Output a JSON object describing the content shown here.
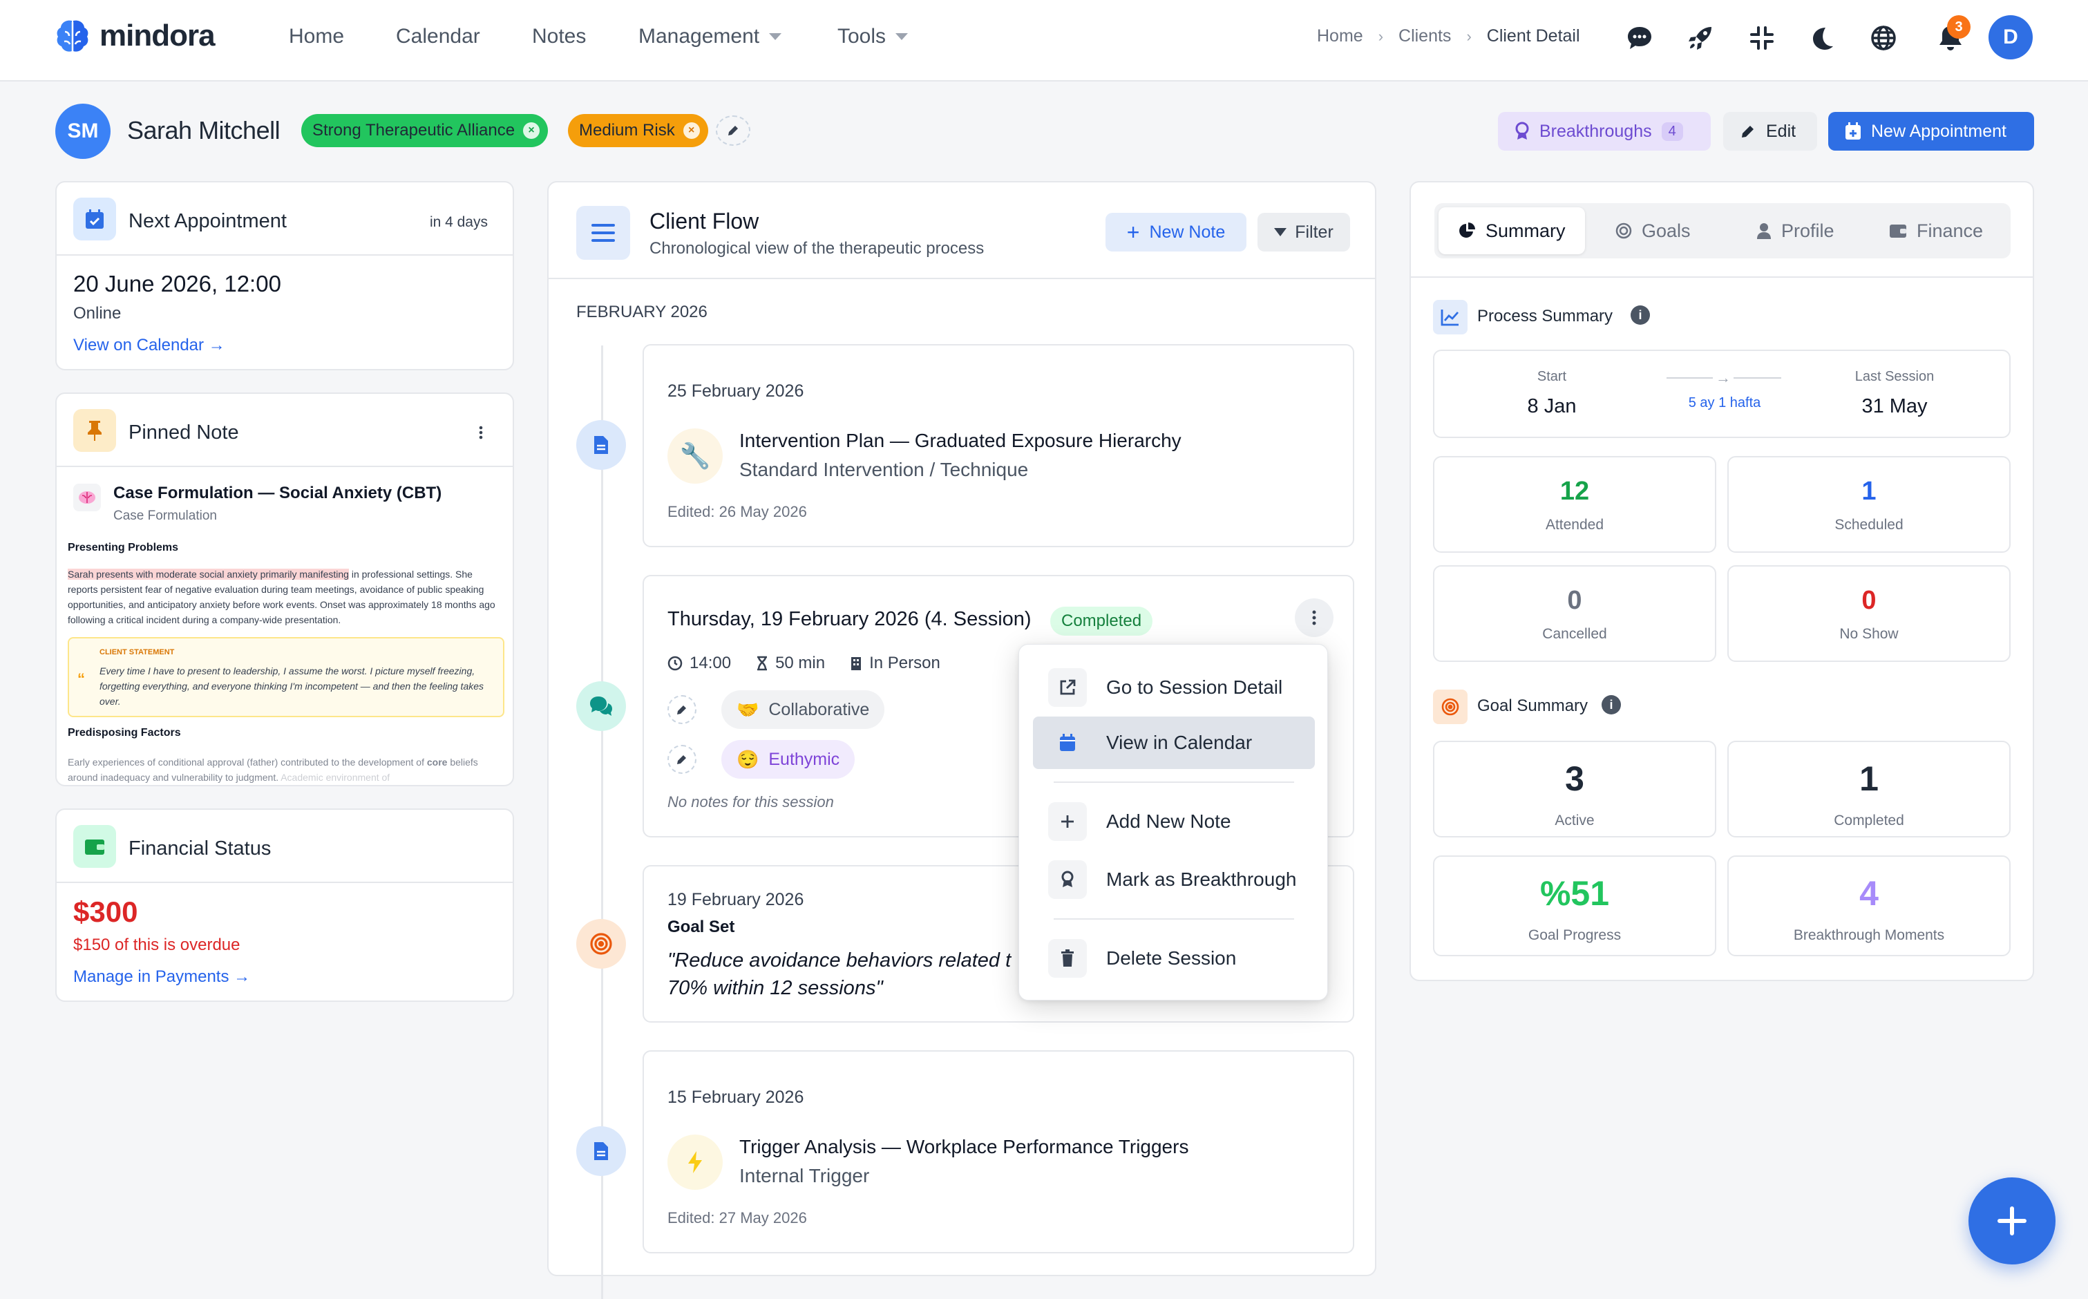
{
  "app": {
    "name": "mindora"
  },
  "nav": {
    "links": [
      "Home",
      "Calendar",
      "Notes",
      "Management",
      "Tools"
    ],
    "breadcrumb": [
      "Home",
      "Clients",
      "Client Detail"
    ],
    "notification_count": "3",
    "user_initial": "D",
    "icons": [
      "chat-icon",
      "rocket-icon",
      "compress-icon",
      "moon-icon",
      "globe-icon",
      "bell-icon"
    ]
  },
  "client": {
    "initials": "SM",
    "name": "Sarah Mitchell",
    "tags": [
      {
        "label": "Strong Therapeutic Alliance",
        "color": "#22c55e"
      },
      {
        "label": "Medium Risk",
        "color": "#f59e0b"
      }
    ]
  },
  "header_actions": {
    "breakthroughs_label": "Breakthroughs",
    "breakthroughs_count": "4",
    "edit_label": "Edit",
    "new_appointment_label": "New Appointment"
  },
  "next_appointment": {
    "title": "Next Appointment",
    "relative": "in 4 days",
    "datetime": "20 June 2026, 12:00",
    "mode": "Online",
    "link": "View on Calendar →"
  },
  "pinned_note": {
    "title": "Pinned Note",
    "note_title": "Case Formulation — Social Anxiety (CBT)",
    "note_type": "Case Formulation",
    "section1": "Presenting Problems",
    "highlight": "Sarah presents with moderate social anxiety primarily manifesting",
    "body": " in professional settings. She reports persistent fear of negative evaluation during team meetings, avoidance of public speaking opportunities, and anticipatory anxiety before work events. Onset was approximately 18 months ago following a critical incident during a company-wide presentation.",
    "quote_label": "CLIENT STATEMENT",
    "quote": "Every time I have to present to leadership, I assume the worst. I picture myself freezing, forgetting everything, and everyone thinking I'm incompetent — and then the feeling takes over.",
    "section2": "Predisposing Factors",
    "body2_a": "Early experiences of conditional approval (father) contributed to the development of ",
    "body2_b": "core",
    "body2_c": " beliefs around inadequacy and vulnerability to judgment. ",
    "body2_d": "Academic environment of"
  },
  "financial": {
    "title": "Financial Status",
    "amount": "$300",
    "overdue": "$150 of this is overdue",
    "link": "Manage in Payments →"
  },
  "flow": {
    "title": "Client Flow",
    "subtitle": "Chronological view of the therapeutic process",
    "new_note_label": "New Note",
    "filter_label": "Filter",
    "month": "FEBRUARY 2026",
    "items": [
      {
        "date": "25 February 2026",
        "title": "Intervention Plan — Graduated Exposure Hierarchy",
        "subtitle": "Standard Intervention / Technique",
        "edited": "Edited: 26 May 2026"
      },
      {
        "title": "Thursday, 19 February 2026 (4. Session)",
        "status": "Completed",
        "time": "14:00",
        "duration": "50 min",
        "mode": "In Person",
        "alliance": "Collaborative",
        "mood": "Euthymic",
        "notes": "No notes for this session"
      },
      {
        "date": "19 February 2026",
        "type": "Goal Set",
        "quote_line1": "\"Reduce avoidance behaviors related t",
        "quote_line2": "70% within 12 sessions\""
      },
      {
        "date": "15 February 2026",
        "title": "Trigger Analysis — Workplace Performance Triggers",
        "subtitle": "Internal Trigger",
        "edited": "Edited: 27 May 2026"
      }
    ]
  },
  "context_menu": {
    "items": [
      "Go to Session Detail",
      "View in Calendar",
      "Add New Note",
      "Mark as Breakthrough",
      "Delete Session"
    ],
    "selected": "View in Calendar"
  },
  "summary": {
    "tabs": [
      "Summary",
      "Goals",
      "Profile",
      "Finance"
    ],
    "active_tab": "Summary",
    "process_title": "Process Summary",
    "start_label": "Start",
    "start_value": "8 Jan",
    "duration": "5 ay 1 hafta",
    "last_label": "Last Session",
    "last_value": "31 May",
    "sessions": [
      {
        "value": "12",
        "label": "Attended",
        "color": "#16a34a"
      },
      {
        "value": "1",
        "label": "Scheduled",
        "color": "#2563eb"
      },
      {
        "value": "0",
        "label": "Cancelled",
        "color": "#6b7280"
      },
      {
        "value": "0",
        "label": "No Show",
        "color": "#dc2626"
      }
    ],
    "goal_title": "Goal Summary",
    "goals": [
      {
        "value": "3",
        "label": "Active",
        "color": "#1f2937"
      },
      {
        "value": "1",
        "label": "Completed",
        "color": "#1f2937"
      },
      {
        "value": "%51",
        "label": "Goal Progress",
        "color": "#22c55e"
      },
      {
        "value": "4",
        "label": "Breakthrough Moments",
        "color": "#a78bfa"
      }
    ]
  }
}
